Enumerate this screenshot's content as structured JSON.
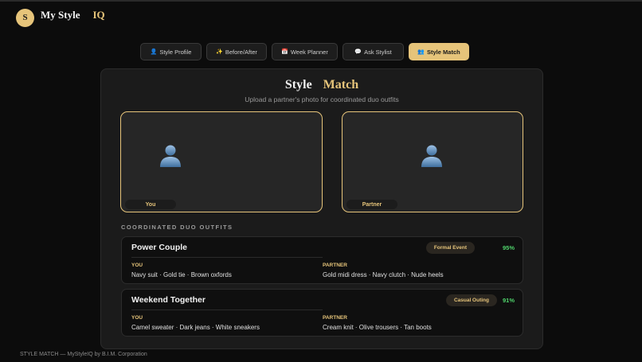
{
  "header": {
    "avatar_letter": "S",
    "brand_main": "My Style",
    "brand_accent": "IQ"
  },
  "tabs": [
    {
      "label": "Style Profile",
      "icon": "👤",
      "active": false
    },
    {
      "label": "Before/After",
      "icon": "✨",
      "active": false
    },
    {
      "label": "Week Planner",
      "icon": "📅",
      "active": false
    },
    {
      "label": "Ask Stylist",
      "icon": "💬",
      "active": false
    },
    {
      "label": "Style Match",
      "icon": "👥",
      "active": true
    }
  ],
  "main": {
    "title_part1": "Style",
    "title_part2": "Match",
    "subtitle": "Upload a partner's photo for coordinated duo outfits",
    "photos": {
      "you_label": "You",
      "partner_label": "Partner"
    },
    "section_label": "COORDINATED DUO OUTFITS",
    "outfits": [
      {
        "name": "Power Couple",
        "badge": "Formal Event",
        "score": "95%",
        "you_role": "YOU",
        "you_items": "Navy suit · Gold tie · Brown oxfords",
        "partner_role": "PARTNER",
        "partner_items": "Gold midi dress · Navy clutch · Nude heels"
      },
      {
        "name": "Weekend Together",
        "badge": "Casual Outing",
        "score": "91%",
        "you_role": "YOU",
        "you_items": "Camel sweater · Dark jeans · White sneakers",
        "partner_role": "PARTNER",
        "partner_items": "Cream knit · Olive trousers · Tan boots"
      }
    ]
  },
  "footer": {
    "text": "STYLE MATCH — MyStyleIQ by B.I.M. Corporation"
  },
  "colors": {
    "accent": "#e6c47a",
    "background": "#0c0c0c",
    "card": "#1b1b1b",
    "score": "#4fd36b"
  }
}
